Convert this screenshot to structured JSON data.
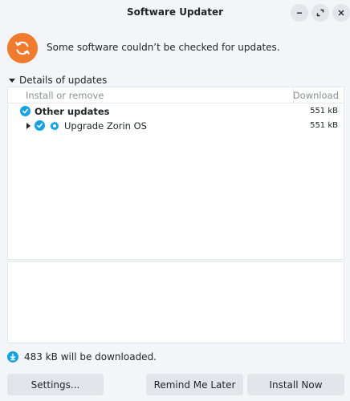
{
  "window": {
    "title": "Software Updater"
  },
  "banner": {
    "message": "Some software couldn’t be checked for updates.",
    "icon": "refresh-icon"
  },
  "details": {
    "toggle_label": "Details of updates",
    "columns": [
      "Install or remove",
      "Download"
    ],
    "groups": [
      {
        "label": "Other updates",
        "size": "551 kB",
        "checked": true,
        "items": [
          {
            "label": "Upgrade Zorin OS",
            "size": "551 kB",
            "checked": true,
            "icon": "gear-icon"
          }
        ]
      }
    ]
  },
  "download_info": "483 kB will be downloaded.",
  "buttons": {
    "settings": "Settings...",
    "remind": "Remind Me Later",
    "install": "Install Now"
  },
  "colors": {
    "accent": "#15a3e5",
    "banner_icon": "#f07a2e"
  }
}
